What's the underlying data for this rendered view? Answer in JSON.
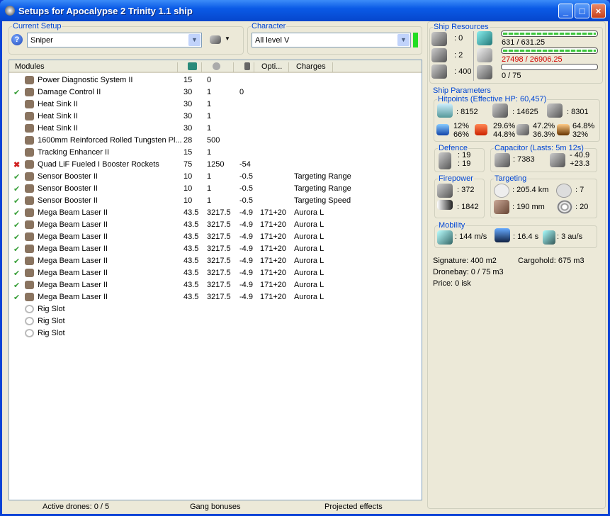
{
  "window": {
    "title": "Setups for Apocalypse 2 Trinity 1.1 ship"
  },
  "setup": {
    "label": "Current Setup",
    "value": "Sniper"
  },
  "character": {
    "label": "Character",
    "value": "All level V"
  },
  "columns": [
    "Modules",
    "Opti...",
    "Charges"
  ],
  "modules": [
    {
      "status": "",
      "name": "Power Diagnostic System II",
      "c1": "15",
      "c2": "0",
      "c3": "",
      "opti": "",
      "charge": ""
    },
    {
      "status": "ok",
      "name": "Damage Control II",
      "c1": "30",
      "c2": "1",
      "c3": "0",
      "opti": "",
      "charge": ""
    },
    {
      "status": "",
      "name": "Heat Sink II",
      "c1": "30",
      "c2": "1",
      "c3": "",
      "opti": "",
      "charge": ""
    },
    {
      "status": "",
      "name": "Heat Sink II",
      "c1": "30",
      "c2": "1",
      "c3": "",
      "opti": "",
      "charge": ""
    },
    {
      "status": "",
      "name": "Heat Sink II",
      "c1": "30",
      "c2": "1",
      "c3": "",
      "opti": "",
      "charge": ""
    },
    {
      "status": "",
      "name": "1600mm Reinforced Rolled Tungsten Pl...",
      "c1": "28",
      "c2": "500",
      "c3": "",
      "opti": "",
      "charge": ""
    },
    {
      "status": "",
      "name": "Tracking Enhancer II",
      "c1": "15",
      "c2": "1",
      "c3": "",
      "opti": "",
      "charge": ""
    },
    {
      "status": "off",
      "name": "Quad LiF Fueled I Booster Rockets",
      "c1": "75",
      "c2": "1250",
      "c3": "-54",
      "opti": "",
      "charge": ""
    },
    {
      "status": "ok",
      "name": "Sensor Booster II",
      "c1": "10",
      "c2": "1",
      "c3": "-0.5",
      "opti": "",
      "charge": "Targeting Range"
    },
    {
      "status": "ok",
      "name": "Sensor Booster II",
      "c1": "10",
      "c2": "1",
      "c3": "-0.5",
      "opti": "",
      "charge": "Targeting Range"
    },
    {
      "status": "ok",
      "name": "Sensor Booster II",
      "c1": "10",
      "c2": "1",
      "c3": "-0.5",
      "opti": "",
      "charge": "Targeting Speed"
    },
    {
      "status": "ok",
      "name": "Mega Beam Laser II",
      "c1": "43.5",
      "c2": "3217.5",
      "c3": "-4.9",
      "opti": "171+20",
      "charge": "Aurora L"
    },
    {
      "status": "ok",
      "name": "Mega Beam Laser II",
      "c1": "43.5",
      "c2": "3217.5",
      "c3": "-4.9",
      "opti": "171+20",
      "charge": "Aurora L"
    },
    {
      "status": "ok",
      "name": "Mega Beam Laser II",
      "c1": "43.5",
      "c2": "3217.5",
      "c3": "-4.9",
      "opti": "171+20",
      "charge": "Aurora L"
    },
    {
      "status": "ok",
      "name": "Mega Beam Laser II",
      "c1": "43.5",
      "c2": "3217.5",
      "c3": "-4.9",
      "opti": "171+20",
      "charge": "Aurora L"
    },
    {
      "status": "ok",
      "name": "Mega Beam Laser II",
      "c1": "43.5",
      "c2": "3217.5",
      "c3": "-4.9",
      "opti": "171+20",
      "charge": "Aurora L"
    },
    {
      "status": "ok",
      "name": "Mega Beam Laser II",
      "c1": "43.5",
      "c2": "3217.5",
      "c3": "-4.9",
      "opti": "171+20",
      "charge": "Aurora L"
    },
    {
      "status": "ok",
      "name": "Mega Beam Laser II",
      "c1": "43.5",
      "c2": "3217.5",
      "c3": "-4.9",
      "opti": "171+20",
      "charge": "Aurora L"
    },
    {
      "status": "ok",
      "name": "Mega Beam Laser II",
      "c1": "43.5",
      "c2": "3217.5",
      "c3": "-4.9",
      "opti": "171+20",
      "charge": "Aurora L"
    },
    {
      "status": "rig",
      "name": "Rig Slot",
      "c1": "",
      "c2": "",
      "c3": "",
      "opti": "",
      "charge": ""
    },
    {
      "status": "rig",
      "name": "Rig Slot",
      "c1": "",
      "c2": "",
      "c3": "",
      "opti": "",
      "charge": ""
    },
    {
      "status": "rig",
      "name": "Rig Slot",
      "c1": "",
      "c2": "",
      "c3": "",
      "opti": "",
      "charge": ""
    }
  ],
  "statusbar": {
    "drones": "Active drones: 0 / 5",
    "gang": "Gang bonuses",
    "projected": "Projected effects"
  },
  "resources": {
    "label": "Ship Resources",
    "turrets": ": 0",
    "launchers": ": 2",
    "calibration": ": 400",
    "cpu": "631 / 631.25",
    "cpu_fill": 1.0,
    "power": "27498 / 26906.25",
    "power_fill": 1.0,
    "drone_bw": "0 / 75",
    "drone_fill": 0,
    "power_color": "#d00000"
  },
  "params": {
    "label": "Ship Parameters",
    "hp": {
      "label": "Hitpoints (Effective HP: 60,457)",
      "shield": ": 8152",
      "armor": ": 14625",
      "structure": ": 8301",
      "res": [
        [
          "12%",
          "66%"
        ],
        [
          "29.6%",
          "44.8%"
        ],
        [
          "47.2%",
          "36.3%"
        ],
        [
          "64.8%",
          "32%"
        ]
      ]
    },
    "defence": {
      "label": "Defence",
      "a": ": 19",
      "b": ": 19"
    },
    "capacitor": {
      "label": "Capacitor (Lasts: 5m 12s)",
      "amount": ": 7383",
      "minus": "- 40.9",
      "plus": "+23.3"
    },
    "firepower": {
      "label": "Firepower",
      "a": ": 372",
      "b": ": 1842"
    },
    "targeting": {
      "label": "Targeting",
      "range": ": 205.4 km",
      "targets": ": 7",
      "scan": ": 190 mm",
      "strength": ": 20"
    },
    "mobility": {
      "label": "Mobility",
      "speed": ": 144 m/s",
      "align": ": 16.4 s",
      "warp": ": 3 au/s"
    },
    "signature": "Signature: 400 m2",
    "cargo": "Cargohold: 675 m3",
    "dronebay": "Dronebay: 0 / 75 m3",
    "price": "Price: 0 isk"
  }
}
